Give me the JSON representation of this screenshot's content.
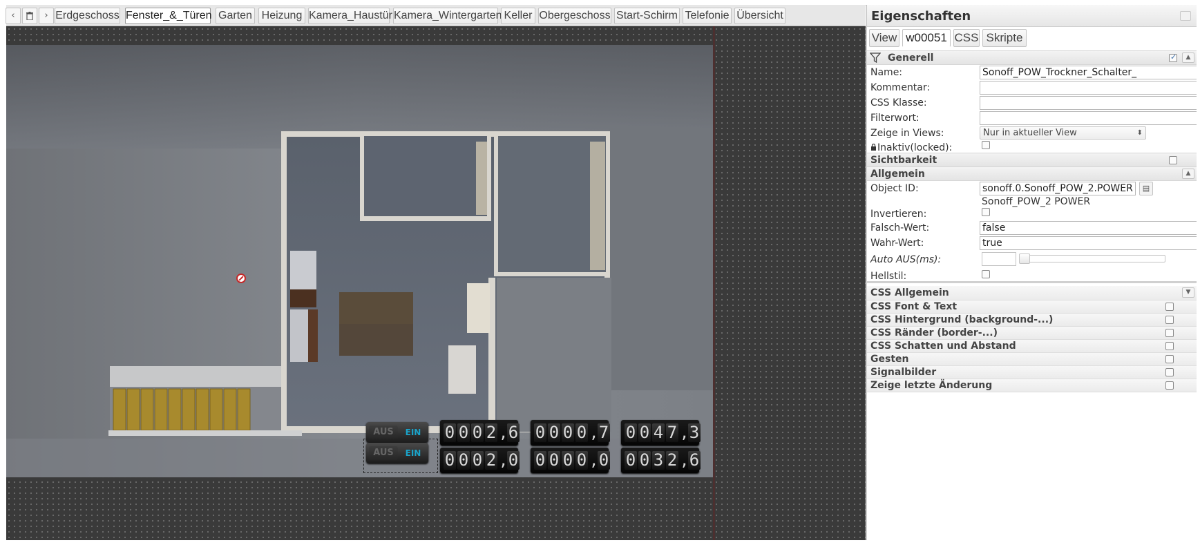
{
  "nav": {
    "prev": "‹",
    "trash": "🗑",
    "next": "›"
  },
  "views": [
    "Erdgeschoss",
    "Fenster_&_Türen",
    "Garten",
    "Heizung",
    "Kamera_Haustür",
    "Kamera_Wintergarten",
    "Keller",
    "Obergeschoss",
    "Start-Schirm",
    "Telefonie",
    "Übersicht"
  ],
  "active_view": "Fenster_&_Türen",
  "panel": {
    "title": "Eigenschaften",
    "tabs": [
      "View",
      "w00051",
      "CSS",
      "Skripte"
    ],
    "active_tab": "w00051",
    "sections": {
      "generell": "Generell",
      "sichtbarkeit": "Sichtbarkeit",
      "allgemein": "Allgemein"
    },
    "fields": {
      "name_label": "Name:",
      "name_value": "Sonoff_POW_Trockner_Schalter_",
      "kommentar_label": "Kommentar:",
      "kommentar_value": "",
      "css_klasse_label": "CSS Klasse:",
      "css_klasse_value": "",
      "filterwort_label": "Filterwort:",
      "filterwort_value": "",
      "zeige_views_label": "Zeige in Views:",
      "zeige_views_value": "Nur in aktueller View",
      "inaktiv_label": "Inaktiv(locked):",
      "object_id_label": "Object ID:",
      "object_id_value": "sonoff.0.Sonoff_POW_2.POWER",
      "object_id_name": "Sonoff_POW_2 POWER",
      "invertieren_label": "Invertieren:",
      "falsch_label": "Falsch-Wert:",
      "falsch_value": "false",
      "wahr_label": "Wahr-Wert:",
      "wahr_value": "true",
      "auto_aus_label": "Auto AUS(ms):",
      "hellstil_label": "Hellstil:"
    },
    "css_sections": [
      "CSS Allgemein",
      "CSS Font & Text",
      "CSS Hintergrund (background-...)",
      "CSS Ränder (border-...)",
      "CSS Schatten und Abstand",
      "Gesten",
      "Signalbilder",
      "Zeige letzte Änderung"
    ],
    "generell_checked": true
  },
  "widgets": {
    "switch_off": "AUS",
    "switch_on": "EIN",
    "row1": [
      "0002,6",
      "0000,7",
      "0047,3"
    ],
    "row2": [
      "0002,0",
      "0000,0",
      "0032,6"
    ]
  },
  "colors": {
    "editor_bg": "#3a3a3a",
    "accent_on": "#1aa3c9",
    "guide_line": "#7a1515"
  }
}
